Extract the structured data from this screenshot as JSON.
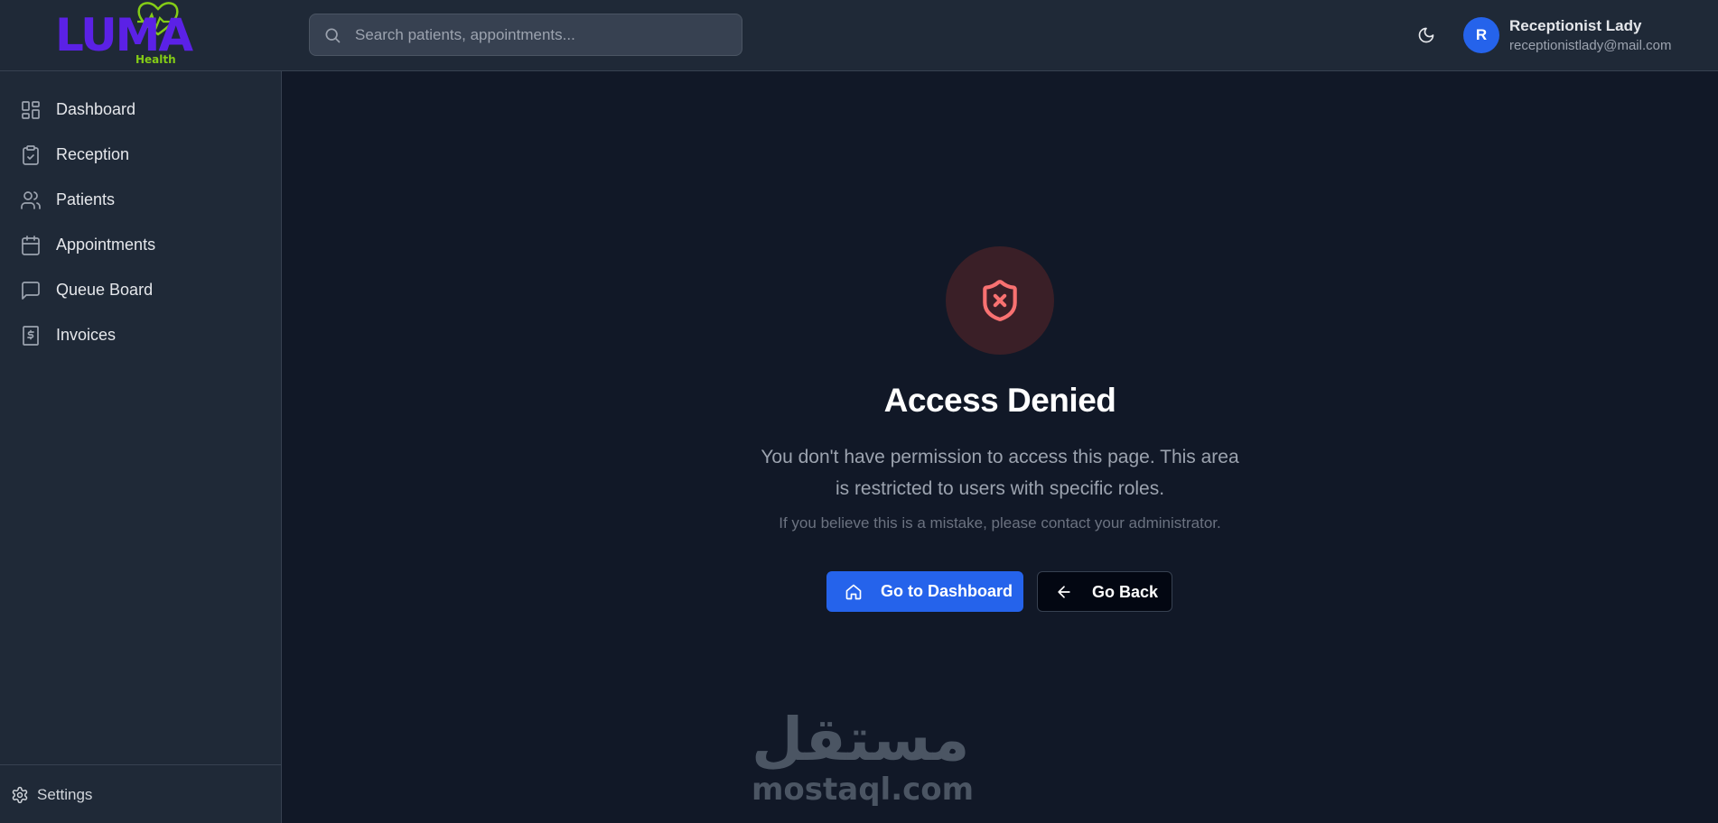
{
  "header": {
    "logo_text": "LUMA",
    "logo_subtext": "Health",
    "search_placeholder": "Search patients, appointments...",
    "theme_icon": "moon-icon",
    "user": {
      "initial": "R",
      "name": "Receptionist Lady",
      "email": "receptionistlady@mail.com"
    }
  },
  "sidebar": {
    "items": [
      {
        "label": "Dashboard",
        "icon": "dashboard-icon"
      },
      {
        "label": "Reception",
        "icon": "clipboard-check-icon"
      },
      {
        "label": "Patients",
        "icon": "users-icon"
      },
      {
        "label": "Appointments",
        "icon": "calendar-icon"
      },
      {
        "label": "Queue Board",
        "icon": "message-square-icon"
      },
      {
        "label": "Invoices",
        "icon": "dollar-receipt-icon"
      }
    ],
    "settings_label": "Settings"
  },
  "main": {
    "icon": "shield-x-icon",
    "title": "Access Denied",
    "description": "You don't have permission to access this page. This area is restricted to users with specific roles.",
    "note": "If you believe this is a mistake, please contact your administrator.",
    "primary_button": "Go to Dashboard",
    "secondary_button": "Go Back"
  },
  "watermark": {
    "arabic": "مستقل",
    "latin": "mostaql.com"
  },
  "colors": {
    "background": "#111827",
    "panel": "#1f2937",
    "accent": "#2563eb",
    "danger": "#f87171",
    "logo": "#5b21e6",
    "logo_accent": "#84cc16"
  }
}
